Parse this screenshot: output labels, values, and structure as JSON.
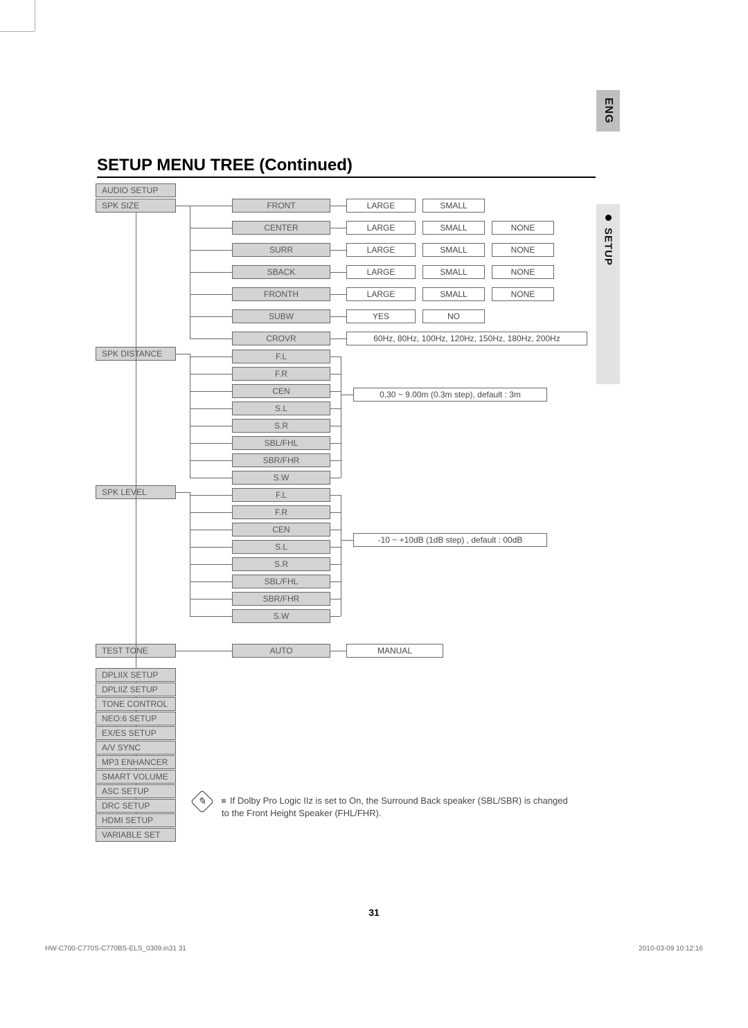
{
  "lang_tab": "ENG",
  "section_tab": "SETUP",
  "title": "SETUP MENU TREE (Continued)",
  "categories": {
    "audio_setup": "AUDIO SETUP",
    "spk_size": "SPK SIZE",
    "spk_distance": "SPK DISTANCE",
    "spk_level": "SPK LEVEL",
    "test_tone": "TEST TONE",
    "other": [
      "DPLIIX SETUP",
      "DPLIIZ SETUP",
      "TONE CONTROL",
      "NEO:6 SETUP",
      "EX/ES SETUP",
      "A/V SYNC",
      "MP3 ENHANCER",
      "SMART VOLUME",
      "ASC SETUP",
      "DRC SETUP",
      "HDMI SETUP",
      "VARIABLE SET"
    ]
  },
  "spk_size": {
    "front": {
      "label": "FRONT",
      "opts": [
        "LARGE",
        "SMALL"
      ]
    },
    "center": {
      "label": "CENTER",
      "opts": [
        "LARGE",
        "SMALL",
        "NONE"
      ]
    },
    "surr": {
      "label": "SURR",
      "opts": [
        "LARGE",
        "SMALL",
        "NONE"
      ]
    },
    "sback": {
      "label": "SBACK",
      "opts": [
        "LARGE",
        "SMALL",
        "NONE"
      ]
    },
    "fronth": {
      "label": "FRONTH",
      "opts": [
        "LARGE",
        "SMALL",
        "NONE"
      ]
    },
    "subw": {
      "label": "SUBW",
      "opts": [
        "YES",
        "NO"
      ]
    },
    "crovr": {
      "label": "CROVR",
      "range": "60Hz, 80Hz, 100Hz, 120Hz, 150Hz, 180Hz, 200Hz"
    }
  },
  "spk_distance": {
    "items": [
      "F.L",
      "F.R",
      "CEN",
      "S.L",
      "S.R",
      "SBL/FHL",
      "SBR/FHR",
      "S.W"
    ],
    "range": "0.30 ~ 9.00m (0.3m step), default : 3m"
  },
  "spk_level": {
    "items": [
      "F.L",
      "F.R",
      "CEN",
      "S.L",
      "S.R",
      "SBL/FHL",
      "SBR/FHR",
      "S.W"
    ],
    "range": "-10 ~ +10dB (1dB step) , default : 00dB"
  },
  "test_tone": {
    "opts": [
      "AUTO",
      "MANUAL"
    ]
  },
  "note": "If Dolby Pro Logic IIz is set to On, the Surround Back speaker (SBL/SBR) is changed to the Front Height Speaker (FHL/FHR).",
  "page_number": "31",
  "footer_left": "HW-C700-C770S-C770BS-ELS_0309.in31   31",
  "footer_right": "2010-03-09   10:12:16"
}
